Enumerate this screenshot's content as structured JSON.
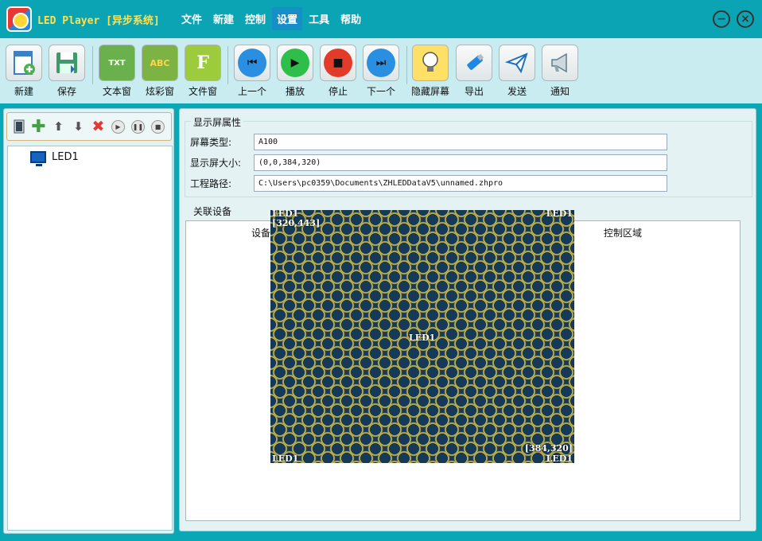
{
  "app": {
    "title": "LED Player [异步系统]"
  },
  "menu": [
    {
      "label": "文件",
      "active": false
    },
    {
      "label": "新建",
      "active": false
    },
    {
      "label": "控制",
      "active": false
    },
    {
      "label": "设置",
      "active": true
    },
    {
      "label": "工具",
      "active": false
    },
    {
      "label": "帮助",
      "active": false
    }
  ],
  "window_controls": {
    "minimize": "−",
    "close": "×"
  },
  "toolbar": {
    "new": "新建",
    "save": "保存",
    "text_window": "文本窗",
    "colorful_window": "炫彩窗",
    "file_window": "文件窗",
    "previous": "上一个",
    "play": "播放",
    "stop": "停止",
    "next": "下一个",
    "hide_screen": "隐藏屏幕",
    "export": "导出",
    "send": "发送",
    "notify": "通知",
    "text_icon_glyph": "TXT",
    "abc_icon_glyph": "ABC",
    "file_icon_glyph": "F"
  },
  "tree": {
    "items": [
      {
        "label": "LED1"
      }
    ]
  },
  "display_props": {
    "title": "显示屏属性",
    "screen_type_label": "屏幕类型:",
    "screen_type_value": "A100",
    "screen_size_label": "显示屏大小:",
    "screen_size_value": "(0,0,384,320)",
    "project_path_label": "工程路径:",
    "project_path_value": "C:\\Users\\pc0359\\Documents\\ZHLEDDataV5\\unnamed.zhpro"
  },
  "linked_devices": {
    "title": "关联设备",
    "columns": [
      "设备",
      "控制区域"
    ]
  },
  "led_preview": {
    "name": "LED1",
    "top_left_label": "LED1",
    "top_right_label": "LED1",
    "bottom_left_label": "LED1",
    "bottom_right_label": "LED1",
    "top_coord": "[320,443]",
    "bottom_coord": "[384,320]",
    "center_label": "LED1"
  },
  "colors": {
    "title_bar": "#0ba4b4",
    "title_text": "#ffe14d",
    "toolbar_bg": "#c9ecf0",
    "active_menu": "#168fc8",
    "led_bg": "#143a58",
    "led_pattern": "#b8a84a"
  }
}
